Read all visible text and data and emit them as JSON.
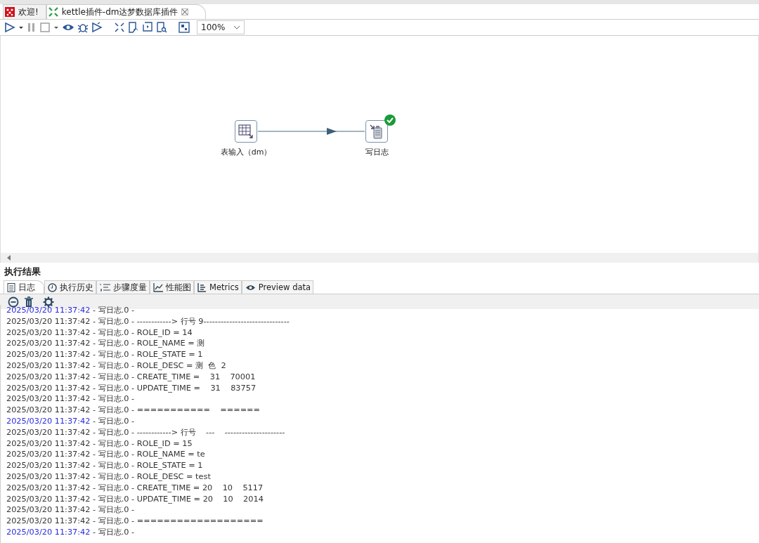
{
  "editor_tabs": [
    {
      "label": "欢迎!",
      "kind": "welcome",
      "selected": false
    },
    {
      "label": "kettle插件-dm达梦数据库插件",
      "kind": "transformation",
      "selected": true,
      "closable": true
    }
  ],
  "zoom": {
    "value": "100%"
  },
  "steps": [
    {
      "label": "表输入（dm）",
      "kind": "table-input",
      "success": false
    },
    {
      "label": "写日志",
      "kind": "write-log",
      "success": true
    }
  ],
  "results": {
    "title": "执行结果",
    "tabs": [
      {
        "label": "日志",
        "selected": true
      },
      {
        "label": "执行历史",
        "selected": false
      },
      {
        "label": "步骤度量",
        "selected": false
      },
      {
        "label": "性能图",
        "selected": false
      },
      {
        "label": "Metrics",
        "selected": false
      },
      {
        "label": "Preview data",
        "selected": false
      }
    ],
    "log": [
      {
        "time": "2025/03/20 11:37:42",
        "text": " - 写日志.0 - ",
        "highlighted": true
      },
      {
        "time": "2025/03/20 11:37:42",
        "text": " - 写日志.0 - ------------> 行号 9------------------------------",
        "highlighted": false
      },
      {
        "time": "2025/03/20 11:37:42",
        "text": " - 写日志.0 - ROLE_ID = 14",
        "highlighted": false
      },
      {
        "time": "2025/03/20 11:37:42",
        "text": " - 写日志.0 - ROLE_NAME = 测",
        "highlighted": false
      },
      {
        "time": "2025/03/20 11:37:42",
        "text": " - 写日志.0 - ROLE_STATE = 1",
        "highlighted": false
      },
      {
        "time": "2025/03/20 11:37:42",
        "text": " - 写日志.0 - ROLE_DESC = 测  色  2",
        "highlighted": false
      },
      {
        "time": "2025/03/20 11:37:42",
        "text": " - 写日志.0 - CREATE_TIME =    31    70001",
        "highlighted": false
      },
      {
        "time": "2025/03/20 11:37:42",
        "text": " - 写日志.0 - UPDATE_TIME =    31    83757",
        "highlighted": false
      },
      {
        "time": "2025/03/20 11:37:42",
        "text": " - 写日志.0 - ",
        "highlighted": false
      },
      {
        "time": "2025/03/20 11:37:42",
        "text": " - 写日志.0 - ===========    ======",
        "highlighted": false
      },
      {
        "time": "2025/03/20 11:37:42",
        "text": " - 写日志.0 - ",
        "highlighted": true
      },
      {
        "time": "2025/03/20 11:37:42",
        "text": " - 写日志.0 - ------------> 行号    ---    ---------------------",
        "highlighted": false
      },
      {
        "time": "2025/03/20 11:37:42",
        "text": " - 写日志.0 - ROLE_ID = 15",
        "highlighted": false
      },
      {
        "time": "2025/03/20 11:37:42",
        "text": " - 写日志.0 - ROLE_NAME = te",
        "highlighted": false
      },
      {
        "time": "2025/03/20 11:37:42",
        "text": " - 写日志.0 - ROLE_STATE = 1",
        "highlighted": false
      },
      {
        "time": "2025/03/20 11:37:42",
        "text": " - 写日志.0 - ROLE_DESC = test",
        "highlighted": false
      },
      {
        "time": "2025/03/20 11:37:42",
        "text": " - 写日志.0 - CREATE_TIME = 20    10    5117",
        "highlighted": false
      },
      {
        "time": "2025/03/20 11:37:42",
        "text": " - 写日志.0 - UPDATE_TIME = 20    10    2014",
        "highlighted": false
      },
      {
        "time": "2025/03/20 11:37:42",
        "text": " - 写日志.0 - ",
        "highlighted": false
      },
      {
        "time": "2025/03/20 11:37:42",
        "text": " - 写日志.0 - ===================",
        "highlighted": false
      },
      {
        "time": "2025/03/20 11:37:42",
        "text": " - 写日志.0 - ",
        "highlighted": true
      }
    ]
  }
}
